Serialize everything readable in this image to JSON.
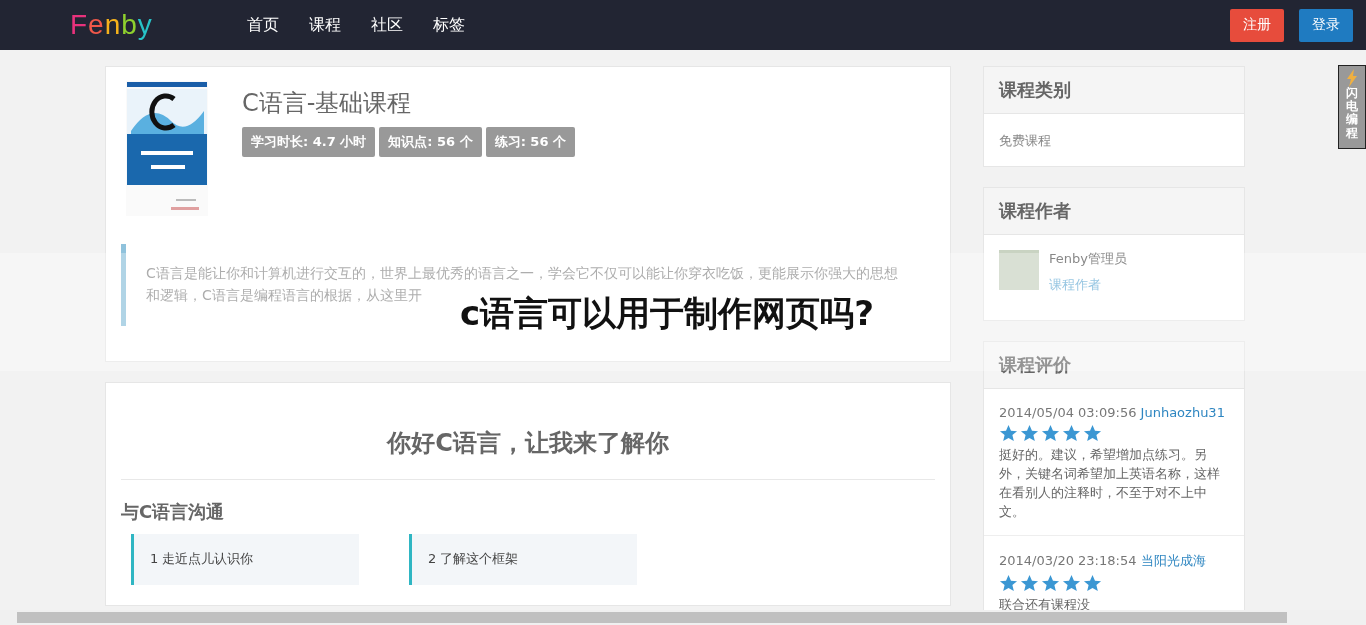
{
  "nav": {
    "logo": "Fenby",
    "links": [
      "首页",
      "课程",
      "社区",
      "标签"
    ],
    "buttons": [
      {
        "label": "注册",
        "kind": "register"
      },
      {
        "label": "登录",
        "kind": "login"
      }
    ]
  },
  "course": {
    "title": "C语言-基础课程",
    "badges": [
      "学习时长: 4.7 小时",
      "知识点: 56 个",
      "练习: 56 个"
    ],
    "description": "C语言是能让你和计算机进行交互的，世界上最优秀的语言之一，学会它不仅可以能让你穿衣吃饭，更能展示你强大的思想和逻辑，C语言是编程语言的根据，从这里开"
  },
  "intro": {
    "heading": "你好C语言，让我来了解你",
    "section": "与C语言沟通",
    "lessons": [
      "1 走近点儿认识你",
      "2 了解这个框架"
    ]
  },
  "sidebar": {
    "category": {
      "title": "课程类别",
      "value": "免费课程"
    },
    "author": {
      "title": "课程作者",
      "name": "Fenby管理员",
      "role": "课程作者"
    },
    "reviews": {
      "title": "课程评价",
      "items": [
        {
          "time": "2014/05/04 03:09:56",
          "user": "Junhaozhu31",
          "stars": 5,
          "text": "挺好的。建议，希望增加点练习。另外，关键名词希望加上英语名称，这样在看别人的注释时，不至于对不上中文。"
        },
        {
          "time": "2014/03/20 23:18:54",
          "user": "当阳光成海",
          "stars": 5,
          "text": "联合还有课程没"
        }
      ]
    }
  },
  "side_widget": {
    "label": "闪电编程"
  },
  "overlay_title": "c语言可以用于制作网页吗?"
}
